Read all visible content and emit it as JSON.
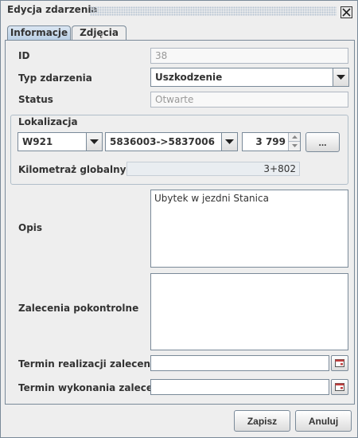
{
  "window": {
    "title": "Edycja zdarzenia"
  },
  "tabs": [
    {
      "label": "Informacje",
      "active": true
    },
    {
      "label": "Zdjęcia",
      "active": false
    }
  ],
  "form": {
    "id": {
      "label": "ID",
      "value": "38"
    },
    "event_type": {
      "label": "Typ zdarzenia",
      "value": "Uszkodzenie"
    },
    "status": {
      "label": "Status",
      "value": "Otwarte"
    },
    "location": {
      "group_label": "Lokalizacja",
      "road": "W921",
      "segment": "5836003->5837006",
      "offset": "3 799",
      "browse_label": "...",
      "global_km_label": "Kilometraż globalny",
      "global_km_value": "3+802"
    },
    "description": {
      "label": "Opis",
      "value": "Ubytek w jezdni Stanica"
    },
    "recommendations": {
      "label": "Zalecenia pokontrolne",
      "value": ""
    },
    "rec_deadline": {
      "label": "Termin realizacji zalecenia",
      "value": ""
    },
    "rec_done": {
      "label": "Termin wykonania zalecenia",
      "value": ""
    }
  },
  "buttons": {
    "save": "Zapisz",
    "cancel": "Anuluj"
  },
  "icons": {
    "close": "close-icon",
    "dropdown": "chevron-down-icon",
    "calendar": "calendar-icon"
  },
  "colors": {
    "border": "#7a8a99",
    "background": "#eeeeee",
    "tab_active": "#b8cfe5"
  }
}
